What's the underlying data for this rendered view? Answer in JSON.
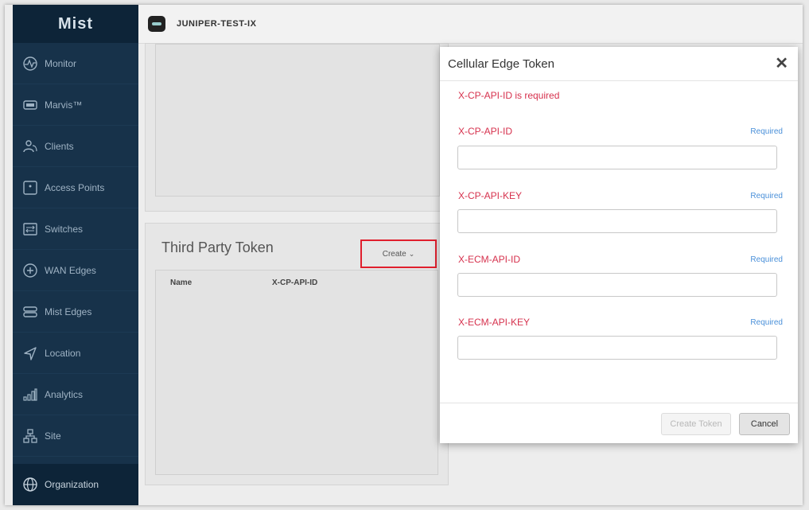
{
  "sidebar": {
    "logo": "Mist",
    "items": [
      {
        "label": "Monitor",
        "icon": "monitor-icon"
      },
      {
        "label": "Marvis™",
        "icon": "marvis-icon"
      },
      {
        "label": "Clients",
        "icon": "clients-icon"
      },
      {
        "label": "Access Points",
        "icon": "access-points-icon"
      },
      {
        "label": "Switches",
        "icon": "switches-icon"
      },
      {
        "label": "WAN Edges",
        "icon": "wan-edges-icon"
      },
      {
        "label": "Mist Edges",
        "icon": "mist-edges-icon"
      },
      {
        "label": "Location",
        "icon": "location-icon"
      },
      {
        "label": "Analytics",
        "icon": "analytics-icon"
      },
      {
        "label": "Site",
        "icon": "site-icon"
      },
      {
        "label": "Organization",
        "icon": "organization-icon"
      }
    ]
  },
  "header": {
    "org_name": "JUNIPER-TEST-IX"
  },
  "third_party": {
    "title": "Third Party Token",
    "create_label": "Create",
    "columns": [
      "Name",
      "X-CP-API-ID"
    ]
  },
  "modal": {
    "title": "Cellular Edge Token",
    "close": "✕",
    "error": "X-CP-API-ID is required",
    "fields": [
      {
        "label": "X-CP-API-ID",
        "required": "Required",
        "value": ""
      },
      {
        "label": "X-CP-API-KEY",
        "required": "Required",
        "value": ""
      },
      {
        "label": "X-ECM-API-ID",
        "required": "Required",
        "value": ""
      },
      {
        "label": "X-ECM-API-KEY",
        "required": "Required",
        "value": ""
      }
    ],
    "create_token_label": "Create Token",
    "cancel_label": "Cancel"
  },
  "colors": {
    "sidebar": "#17324a",
    "error": "#d6314d",
    "required": "#4a90d9",
    "highlight": "#e01f2d"
  }
}
